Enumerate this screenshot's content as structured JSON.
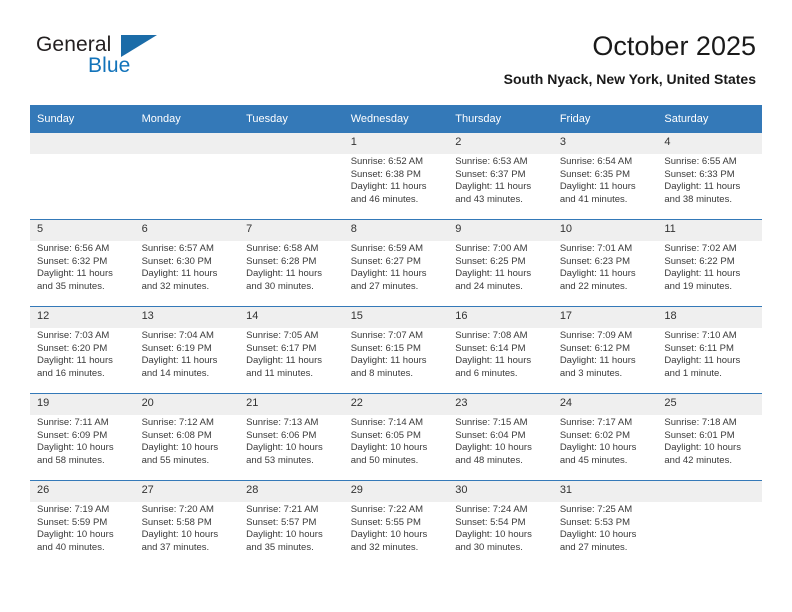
{
  "brand": {
    "name_part1": "General",
    "name_part2": "Blue",
    "logo_icon": "triangle-logo-icon",
    "accent_color": "#1273ba",
    "header_color": "#3479b8"
  },
  "header": {
    "title": "October 2025",
    "subtitle": "South Nyack, New York, United States"
  },
  "calendar": {
    "weekday_headers": [
      "Sunday",
      "Monday",
      "Tuesday",
      "Wednesday",
      "Thursday",
      "Friday",
      "Saturday"
    ],
    "labels": {
      "sunrise": "Sunrise:",
      "sunset": "Sunset:",
      "daylight": "Daylight:"
    },
    "weeks": [
      [
        {
          "day": "",
          "sunrise": "",
          "sunset": "",
          "daylight_line1": "",
          "daylight_line2": ""
        },
        {
          "day": "",
          "sunrise": "",
          "sunset": "",
          "daylight_line1": "",
          "daylight_line2": ""
        },
        {
          "day": "",
          "sunrise": "",
          "sunset": "",
          "daylight_line1": "",
          "daylight_line2": ""
        },
        {
          "day": "1",
          "sunrise": "Sunrise: 6:52 AM",
          "sunset": "Sunset: 6:38 PM",
          "daylight_line1": "Daylight: 11 hours",
          "daylight_line2": "and 46 minutes."
        },
        {
          "day": "2",
          "sunrise": "Sunrise: 6:53 AM",
          "sunset": "Sunset: 6:37 PM",
          "daylight_line1": "Daylight: 11 hours",
          "daylight_line2": "and 43 minutes."
        },
        {
          "day": "3",
          "sunrise": "Sunrise: 6:54 AM",
          "sunset": "Sunset: 6:35 PM",
          "daylight_line1": "Daylight: 11 hours",
          "daylight_line2": "and 41 minutes."
        },
        {
          "day": "4",
          "sunrise": "Sunrise: 6:55 AM",
          "sunset": "Sunset: 6:33 PM",
          "daylight_line1": "Daylight: 11 hours",
          "daylight_line2": "and 38 minutes."
        }
      ],
      [
        {
          "day": "5",
          "sunrise": "Sunrise: 6:56 AM",
          "sunset": "Sunset: 6:32 PM",
          "daylight_line1": "Daylight: 11 hours",
          "daylight_line2": "and 35 minutes."
        },
        {
          "day": "6",
          "sunrise": "Sunrise: 6:57 AM",
          "sunset": "Sunset: 6:30 PM",
          "daylight_line1": "Daylight: 11 hours",
          "daylight_line2": "and 32 minutes."
        },
        {
          "day": "7",
          "sunrise": "Sunrise: 6:58 AM",
          "sunset": "Sunset: 6:28 PM",
          "daylight_line1": "Daylight: 11 hours",
          "daylight_line2": "and 30 minutes."
        },
        {
          "day": "8",
          "sunrise": "Sunrise: 6:59 AM",
          "sunset": "Sunset: 6:27 PM",
          "daylight_line1": "Daylight: 11 hours",
          "daylight_line2": "and 27 minutes."
        },
        {
          "day": "9",
          "sunrise": "Sunrise: 7:00 AM",
          "sunset": "Sunset: 6:25 PM",
          "daylight_line1": "Daylight: 11 hours",
          "daylight_line2": "and 24 minutes."
        },
        {
          "day": "10",
          "sunrise": "Sunrise: 7:01 AM",
          "sunset": "Sunset: 6:23 PM",
          "daylight_line1": "Daylight: 11 hours",
          "daylight_line2": "and 22 minutes."
        },
        {
          "day": "11",
          "sunrise": "Sunrise: 7:02 AM",
          "sunset": "Sunset: 6:22 PM",
          "daylight_line1": "Daylight: 11 hours",
          "daylight_line2": "and 19 minutes."
        }
      ],
      [
        {
          "day": "12",
          "sunrise": "Sunrise: 7:03 AM",
          "sunset": "Sunset: 6:20 PM",
          "daylight_line1": "Daylight: 11 hours",
          "daylight_line2": "and 16 minutes."
        },
        {
          "day": "13",
          "sunrise": "Sunrise: 7:04 AM",
          "sunset": "Sunset: 6:19 PM",
          "daylight_line1": "Daylight: 11 hours",
          "daylight_line2": "and 14 minutes."
        },
        {
          "day": "14",
          "sunrise": "Sunrise: 7:05 AM",
          "sunset": "Sunset: 6:17 PM",
          "daylight_line1": "Daylight: 11 hours",
          "daylight_line2": "and 11 minutes."
        },
        {
          "day": "15",
          "sunrise": "Sunrise: 7:07 AM",
          "sunset": "Sunset: 6:15 PM",
          "daylight_line1": "Daylight: 11 hours",
          "daylight_line2": "and 8 minutes."
        },
        {
          "day": "16",
          "sunrise": "Sunrise: 7:08 AM",
          "sunset": "Sunset: 6:14 PM",
          "daylight_line1": "Daylight: 11 hours",
          "daylight_line2": "and 6 minutes."
        },
        {
          "day": "17",
          "sunrise": "Sunrise: 7:09 AM",
          "sunset": "Sunset: 6:12 PM",
          "daylight_line1": "Daylight: 11 hours",
          "daylight_line2": "and 3 minutes."
        },
        {
          "day": "18",
          "sunrise": "Sunrise: 7:10 AM",
          "sunset": "Sunset: 6:11 PM",
          "daylight_line1": "Daylight: 11 hours",
          "daylight_line2": "and 1 minute."
        }
      ],
      [
        {
          "day": "19",
          "sunrise": "Sunrise: 7:11 AM",
          "sunset": "Sunset: 6:09 PM",
          "daylight_line1": "Daylight: 10 hours",
          "daylight_line2": "and 58 minutes."
        },
        {
          "day": "20",
          "sunrise": "Sunrise: 7:12 AM",
          "sunset": "Sunset: 6:08 PM",
          "daylight_line1": "Daylight: 10 hours",
          "daylight_line2": "and 55 minutes."
        },
        {
          "day": "21",
          "sunrise": "Sunrise: 7:13 AM",
          "sunset": "Sunset: 6:06 PM",
          "daylight_line1": "Daylight: 10 hours",
          "daylight_line2": "and 53 minutes."
        },
        {
          "day": "22",
          "sunrise": "Sunrise: 7:14 AM",
          "sunset": "Sunset: 6:05 PM",
          "daylight_line1": "Daylight: 10 hours",
          "daylight_line2": "and 50 minutes."
        },
        {
          "day": "23",
          "sunrise": "Sunrise: 7:15 AM",
          "sunset": "Sunset: 6:04 PM",
          "daylight_line1": "Daylight: 10 hours",
          "daylight_line2": "and 48 minutes."
        },
        {
          "day": "24",
          "sunrise": "Sunrise: 7:17 AM",
          "sunset": "Sunset: 6:02 PM",
          "daylight_line1": "Daylight: 10 hours",
          "daylight_line2": "and 45 minutes."
        },
        {
          "day": "25",
          "sunrise": "Sunrise: 7:18 AM",
          "sunset": "Sunset: 6:01 PM",
          "daylight_line1": "Daylight: 10 hours",
          "daylight_line2": "and 42 minutes."
        }
      ],
      [
        {
          "day": "26",
          "sunrise": "Sunrise: 7:19 AM",
          "sunset": "Sunset: 5:59 PM",
          "daylight_line1": "Daylight: 10 hours",
          "daylight_line2": "and 40 minutes."
        },
        {
          "day": "27",
          "sunrise": "Sunrise: 7:20 AM",
          "sunset": "Sunset: 5:58 PM",
          "daylight_line1": "Daylight: 10 hours",
          "daylight_line2": "and 37 minutes."
        },
        {
          "day": "28",
          "sunrise": "Sunrise: 7:21 AM",
          "sunset": "Sunset: 5:57 PM",
          "daylight_line1": "Daylight: 10 hours",
          "daylight_line2": "and 35 minutes."
        },
        {
          "day": "29",
          "sunrise": "Sunrise: 7:22 AM",
          "sunset": "Sunset: 5:55 PM",
          "daylight_line1": "Daylight: 10 hours",
          "daylight_line2": "and 32 minutes."
        },
        {
          "day": "30",
          "sunrise": "Sunrise: 7:24 AM",
          "sunset": "Sunset: 5:54 PM",
          "daylight_line1": "Daylight: 10 hours",
          "daylight_line2": "and 30 minutes."
        },
        {
          "day": "31",
          "sunrise": "Sunrise: 7:25 AM",
          "sunset": "Sunset: 5:53 PM",
          "daylight_line1": "Daylight: 10 hours",
          "daylight_line2": "and 27 minutes."
        },
        {
          "day": "",
          "sunrise": "",
          "sunset": "",
          "daylight_line1": "",
          "daylight_line2": ""
        }
      ]
    ]
  }
}
